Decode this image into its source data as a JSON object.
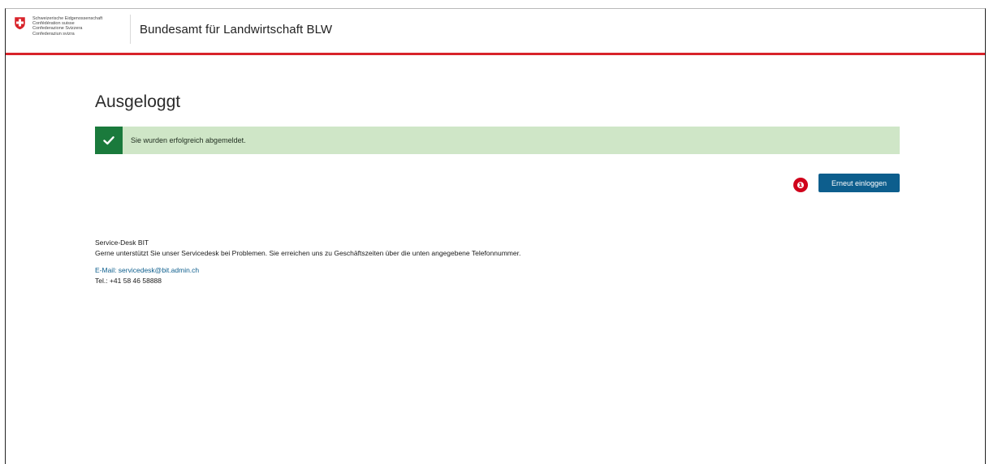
{
  "header": {
    "coat_of_arms_lines": [
      "Schweizerische Eidgenossenschaft",
      "Confédération suisse",
      "Confederazione Svizzera",
      "Confederaziun svizra"
    ],
    "office_title": "Bundesamt für Landwirtschaft BLW",
    "accent_color": "#d8232a",
    "icon": "swiss-shield-icon"
  },
  "main": {
    "page_title": "Ausgeloggt",
    "alert": {
      "message": "Sie wurden erfolgreich abgemeldet.",
      "icon": "checkmark-icon",
      "color": "#1a7a3c",
      "background": "#cfe6c7"
    },
    "marker_number": "❶",
    "relogin_button_label": "Erneut einloggen",
    "button_color": "#0d5e8d"
  },
  "service_desk": {
    "title": "Service-Desk BIT",
    "description": "Gerne unterstützt Sie unser Servicedesk bei Problemen. Sie erreichen uns zu Geschäftszeiten über die unten angegebene Telefonnummer.",
    "email_text": "E-Mail: servicedesk@bit.admin.ch",
    "phone_text": "Tel.: +41 58 46 58888"
  }
}
